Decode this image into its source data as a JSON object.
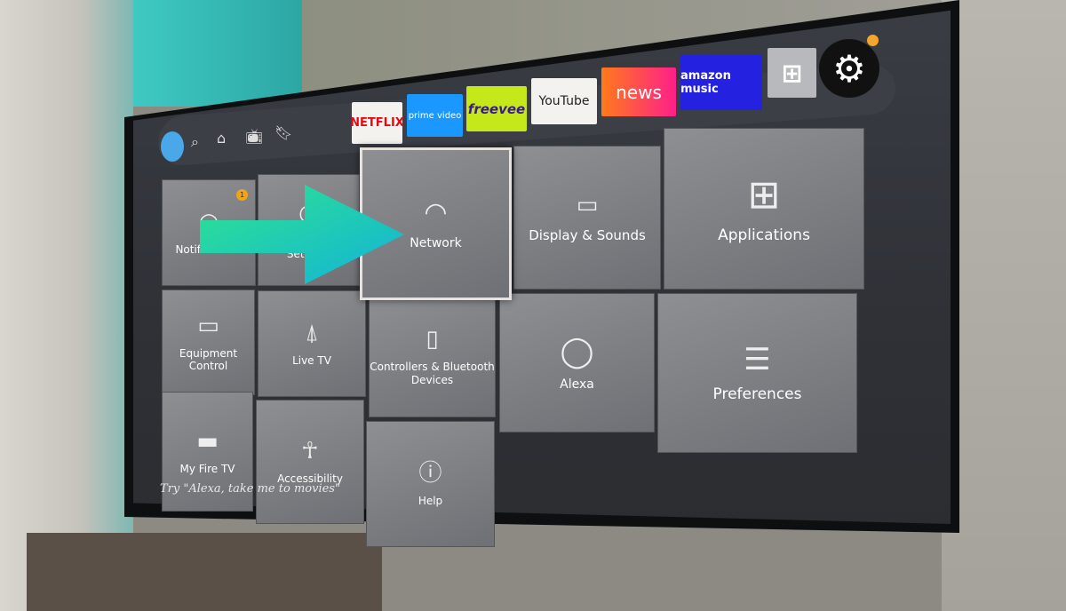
{
  "nav": {
    "icons": [
      "avatar",
      "search-icon",
      "home-icon",
      "live-tv-icon",
      "bookmark-icon"
    ]
  },
  "apps": [
    {
      "label": "NETFLIX",
      "bg": "#f4f2ef",
      "fg": "#e50914"
    },
    {
      "label": "prime video",
      "bg": "#1a98ff",
      "fg": "#ffffff"
    },
    {
      "label": "freevee",
      "bg": "#c5e81b",
      "fg": "#3b1a8c"
    },
    {
      "label": "YouTube",
      "bg": "#f4f2ef",
      "fg": "#222222"
    },
    {
      "label": "news",
      "bg": "#ff5a2a",
      "fg": "#ffffff"
    },
    {
      "label": "amazon music",
      "bg": "#2521e0",
      "fg": "#ffffff"
    }
  ],
  "notification_count": "1",
  "tiles": {
    "notifications": "Notifications",
    "account": "Account & Profile Settings",
    "network": "Network",
    "display": "Display & Sounds",
    "applications": "Applications",
    "equipment": "Equipment Control",
    "livetv": "Live TV",
    "controllers": "Controllers & Bluetooth Devices",
    "alexa": "Alexa",
    "preferences": "Preferences",
    "myfiretv": "My Fire TV",
    "accessibility": "Accessibility",
    "help": "Help"
  },
  "hint": "Try \"Alexa, take me to movies\"",
  "colors": {
    "arrow_start": "#2fe48f",
    "arrow_end": "#12b3d8",
    "focus_border": "#e8e2dc"
  }
}
